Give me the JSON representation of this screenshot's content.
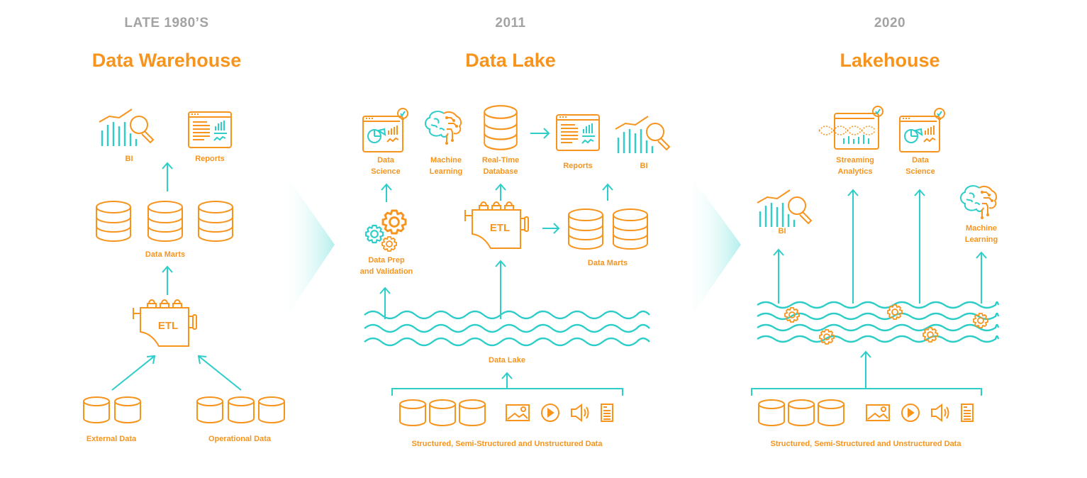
{
  "colors": {
    "orange": "#f7941d",
    "teal": "#2dcdc9",
    "gray": "#a3a3a3"
  },
  "sections": [
    {
      "era": "LATE 1980’S",
      "title": "Data Warehouse",
      "labels": {
        "bi": "BI",
        "reports": "Reports",
        "data_marts": "Data Marts",
        "etl": "ETL",
        "external_data": "External Data",
        "operational_data": "Operational Data"
      }
    },
    {
      "era": "2011",
      "title": "Data Lake",
      "labels": {
        "data_science_1": "Data",
        "data_science_2": "Science",
        "machine_learning_1": "Machine",
        "machine_learning_2": "Learning",
        "realtime_db_1": "Real-Time",
        "realtime_db_2": "Database",
        "reports": "Reports",
        "bi": "BI",
        "data_prep_1": "Data Prep",
        "data_prep_2": "and Validation",
        "etl": "ETL",
        "data_marts": "Data Marts",
        "data_lake": "Data Lake",
        "sources": "Structured, Semi-Structured and Unstructured Data"
      }
    },
    {
      "era": "2020",
      "title": "Lakehouse",
      "labels": {
        "streaming_1": "Streaming",
        "streaming_2": "Analytics",
        "data_science_1": "Data",
        "data_science_2": "Science",
        "bi": "BI",
        "machine_learning_1": "Machine",
        "machine_learning_2": "Learning",
        "sources": "Structured, Semi-Structured and Unstructured Data"
      }
    }
  ],
  "icons": {
    "bi": "bi-chart-magnifier-icon",
    "reports": "report-dashboard-icon",
    "database": "database-icon",
    "etl": "etl-engine-icon",
    "data_science": "data-science-dashboard-icon",
    "machine_learning": "brain-circuit-icon",
    "gears": "gears-icon",
    "waves": "water-waves-icon",
    "image": "image-icon",
    "video": "play-icon",
    "audio": "speaker-icon",
    "document": "document-icon",
    "arrow": "arrow-icon",
    "chevron": "chevron-right-icon"
  }
}
